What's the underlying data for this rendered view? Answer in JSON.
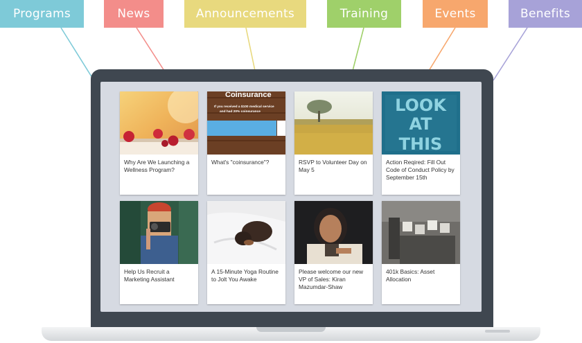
{
  "categories": [
    {
      "label": "Programs",
      "color": "#7ecad8"
    },
    {
      "label": "News",
      "color": "#f38d8a"
    },
    {
      "label": "Announcements",
      "color": "#e8d97e"
    },
    {
      "label": "Training",
      "color": "#9fd06a"
    },
    {
      "label": "Events",
      "color": "#f7a76d"
    },
    {
      "label": "Benefits",
      "color": "#a7a2d8"
    }
  ],
  "cards": [
    {
      "title": "Why Are We Launching a Wellness Program?",
      "image": "raspberries-photo"
    },
    {
      "title": "What's \"coinsurance\"?",
      "image": "coinsurance-graphic",
      "image_text": {
        "heading": "Coinsurance",
        "line1": "If you received a $100 medical service",
        "line2": "and had 20% coinsurance"
      }
    },
    {
      "title": "RSVP to Volunteer Day on May 5",
      "image": "tree-field-photo"
    },
    {
      "title": "Action Reqired: Fill Out Code of Conduct Policy by September 15th",
      "image": "look-at-this-graphic",
      "image_text": {
        "line1": "LOOK",
        "line2": "AT",
        "line3": "THIS"
      }
    },
    {
      "title": "Help Us Recruit a Marketing Assistant",
      "image": "photographer-photo"
    },
    {
      "title": "A 15-Minute Yoga Routine to Jolt You Awake",
      "image": "puppy-photo"
    },
    {
      "title": "Please welcome our new VP of Sales: Kiran Mazumdar-Shaw",
      "image": "portrait-photo"
    },
    {
      "title": "401k Basics: Asset Allocation",
      "image": "vintage-photo"
    }
  ]
}
